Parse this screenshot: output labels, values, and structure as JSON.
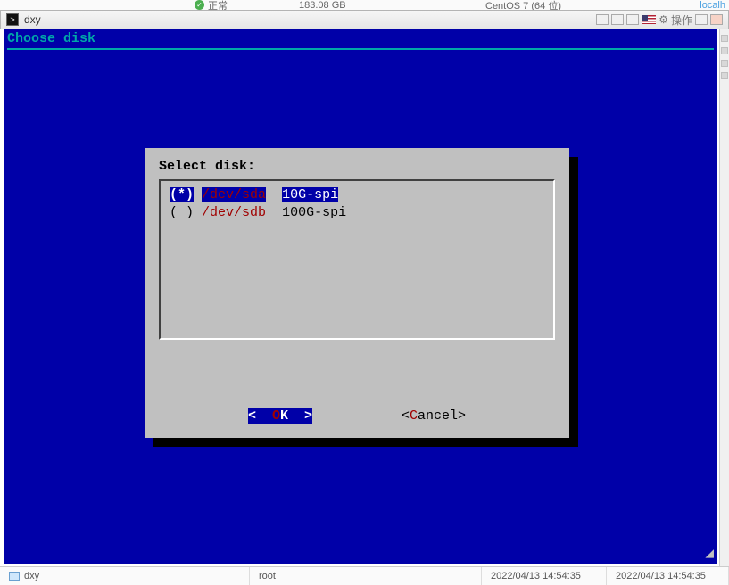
{
  "topbar": {
    "status_text": "正常",
    "disk_size": "183.08 GB",
    "os": "CentOS 7 (64 位)",
    "host": "localh"
  },
  "window": {
    "title": "dxy",
    "actions_label": "操作"
  },
  "terminal": {
    "title": "Choose disk"
  },
  "dialog": {
    "title": "Select disk:",
    "items": [
      {
        "mark": "(*)",
        "path": "/dev/sda",
        "size": "10G-spi"
      },
      {
        "mark": "( )",
        "path": "/dev/sdb",
        "size": "100G-spi"
      }
    ],
    "ok_prefix": "<  ",
    "ok_hot": "O",
    "ok_rest": "K  >",
    "cancel_prefix": "<",
    "cancel_hot": "C",
    "cancel_rest": "ancel>"
  },
  "bottombar": {
    "tab_name": "dxy",
    "user": "root",
    "time1": "2022/04/13 14:54:35",
    "time2": "2022/04/13 14:54:35"
  }
}
